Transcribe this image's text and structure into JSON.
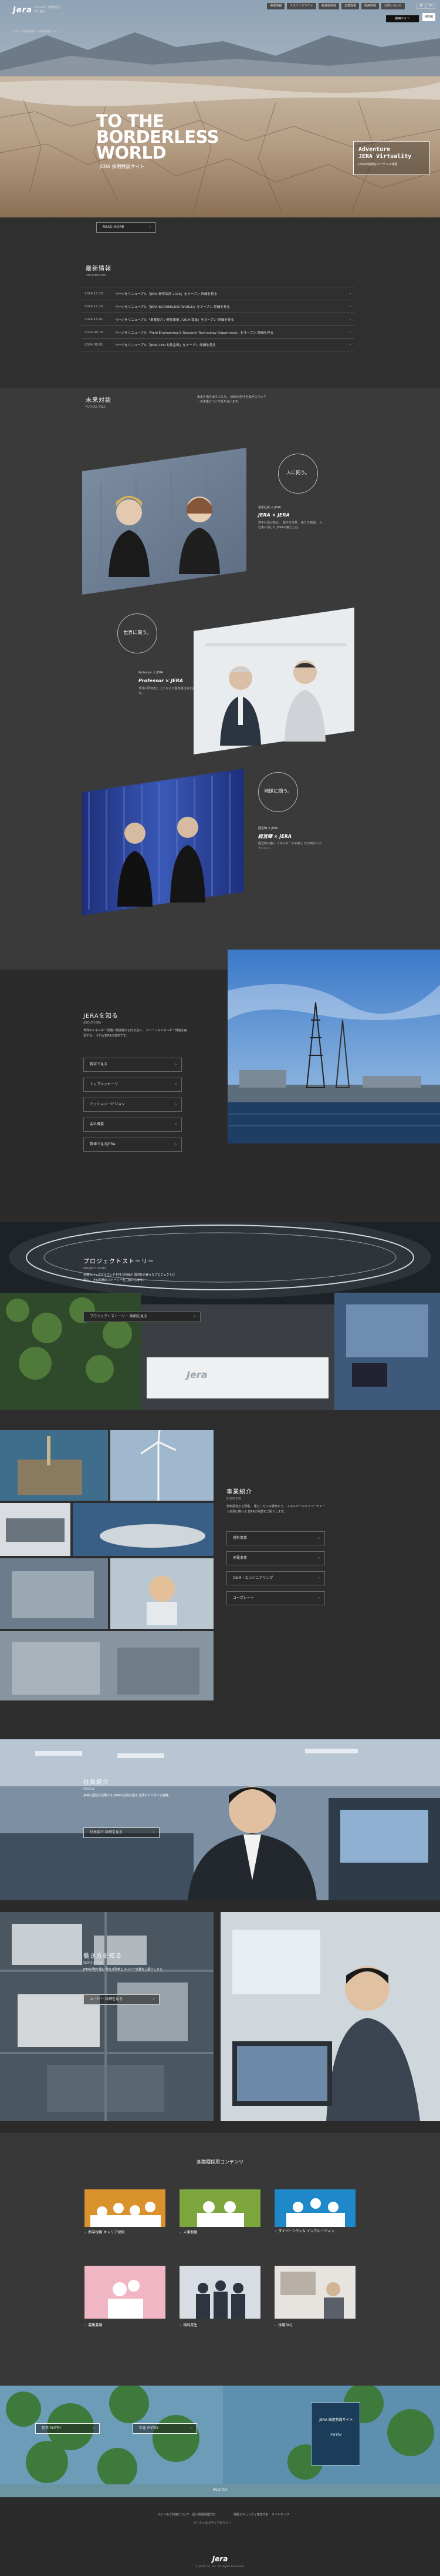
{
  "header": {
    "logo": "Jera",
    "logo_sub_1": "エネルギー新時代を",
    "logo_sub_2": "切り拓く",
    "nav": [
      "事業情報",
      "サステナビリティ",
      "投資家情報",
      "企業情報",
      "採用情報",
      "お問い合わせ"
    ],
    "lang": [
      "JP",
      "EN"
    ],
    "recruit": "採用サイト",
    "menu": "MENU"
  },
  "breadcrumb": "TOP > 採用情報 > 採用特設サイト",
  "hero": {
    "title_1": "TO THE",
    "title_2": "BORDERLESS",
    "title_3": "WORLD",
    "subtitle": "JERA 採用特設サイト",
    "badge_1": "Adventure",
    "badge_2": "JERA Virtuality",
    "badge_sub": "JERAの挑戦をバーチャル体験"
  },
  "intro_button": "READ MORE",
  "news": {
    "title": "最新情報",
    "sub": "INFORMATION",
    "items": [
      {
        "date": "2024.11.20",
        "text": "ページをリニューアル「JERA 新卒採用 2026」をオープン 詳細を見る"
      },
      {
        "date": "2024.11.10",
        "text": "ページをリニューアル「JERA BORDERLESS WORLD」をオープン 詳細を見る"
      },
      {
        "date": "2024.10.01",
        "text": "ページをリニューアル「事業紹介 / 発電事業 / O&M 領域」をオープン 詳細を見る"
      },
      {
        "date": "2024.09.10",
        "text": "ページをリニューアル「Field Engineering & Research Technology Department」をオープン 詳細を見る"
      },
      {
        "date": "2024.08.01",
        "text": "ページをリニューアル「JERA CEO 対談企画」をオープン 詳細を見る"
      }
    ]
  },
  "future": {
    "title": "未来対談",
    "sub": "FUTURE TALK",
    "lead": "未来を描き出す人たち。 JERAの若手社員がエネルギーの未来について語り合います。",
    "talks": [
      {
        "tag": "人に問う。",
        "label": "若手社員 × JERA",
        "name": "JERA × JERA",
        "text": "若手社員が語る、 働き方改革、 新たな挑戦、 入社後に感じた JERAの魅力とは。"
      },
      {
        "tag": "世界に問う。",
        "label": "Professor × JERA",
        "name": "Professor × JERA",
        "text": "世界の研究者と これからの脱炭素社会を語る。"
      },
      {
        "tag": "地球に問う。",
        "label": "経営陣 × JERA",
        "name": "経営陣 × JERA",
        "text": "経営陣が描く エネルギーの未来と 次の時代へのビジョン。"
      }
    ]
  },
  "about": {
    "title": "JERAを知る",
    "sub": "ABOUT JERA",
    "text": "世界のエネルギー問題に最前線から向き合い、 クリーンなエネルギー供給を実現する。 それがJERAの使命です。",
    "links": [
      "数字で見る",
      "トップメッセージ",
      "ミッション・ビジョン",
      "会社概要",
      "数値で見るJERA"
    ]
  },
  "project": {
    "title": "プロジェクトストーリー",
    "sub": "PROJECT STORY",
    "text": "多様なバックグラウンドを持つ社員が 国内外の様々なプロジェクトに挑む。 その挑戦のストーリーをご紹介します。",
    "button": "プロジェクトストーリー 詳細を見る",
    "logo": "Jera"
  },
  "business": {
    "title": "事業紹介",
    "sub": "BUSINESS",
    "text": "燃料調達から発電、 電力・ガスの販売まで。 エネルギーのバリューチェーン全体に携わる JERAの事業をご紹介します。",
    "links": [
      "燃料事業",
      "発電事業",
      "O&M・エンジニアリング",
      "コーポレート"
    ]
  },
  "people": {
    "title": "社員紹介",
    "sub": "PEOPLE",
    "text": "多様な個性が活躍する JERAの社員が語る 仕事のやりがいと挑戦。",
    "button": "社員紹介 詳細を見る"
  },
  "work": {
    "title": "働き方を知る",
    "sub": "WORK STYLE",
    "text": "JERAが取り組む 働き方改革と キャリア支援をご紹介します。",
    "button": "ムービー 詳細を見る"
  },
  "contents": {
    "title": "各職種採用コンテンツ",
    "tiles": [
      "新卒採用 キャリア採用",
      "人事制度",
      "ダイバーシティ& インクルージョン",
      "募集要項",
      "福利厚生",
      "採用FAQ"
    ]
  },
  "entry": {
    "buttons": [
      "新卒 ENTRY",
      "中途 ENTRY"
    ],
    "box_title": "JERA 採用特設サイト",
    "box_sub": "ENTRY"
  },
  "pagetop": "PAGE TOP",
  "footer": {
    "links_1": "サイトのご利用について　個人情報保護方針",
    "links_2": "情報セキュリティ基本方針　サイトマップ",
    "links_3": "ソーシャルメディアポリシー",
    "logo": "Jera",
    "copyright": "© JERA Co., Inc. All Rights Reserved."
  }
}
